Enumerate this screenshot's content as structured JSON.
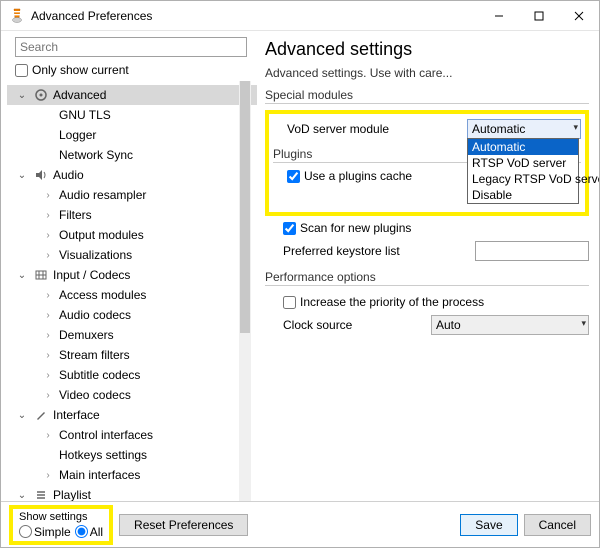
{
  "window": {
    "title": "Advanced Preferences"
  },
  "search": {
    "placeholder": "Search"
  },
  "only_show_current": "Only show current",
  "tree": {
    "advanced": "Advanced",
    "gnu_tls": "GNU TLS",
    "logger": "Logger",
    "network_sync": "Network Sync",
    "audio": "Audio",
    "audio_resampler": "Audio resampler",
    "filters": "Filters",
    "output_modules": "Output modules",
    "visualizations": "Visualizations",
    "input_codecs": "Input / Codecs",
    "access_modules": "Access modules",
    "audio_codecs": "Audio codecs",
    "demuxers": "Demuxers",
    "stream_filters": "Stream filters",
    "subtitle_codecs": "Subtitle codecs",
    "video_codecs": "Video codecs",
    "interface": "Interface",
    "control_interfaces": "Control interfaces",
    "hotkeys_settings": "Hotkeys settings",
    "main_interfaces": "Main interfaces",
    "playlist": "Playlist"
  },
  "right": {
    "heading": "Advanced settings",
    "subtext": "Advanced settings. Use with care...",
    "special_modules": "Special modules",
    "vod_label": "VoD server module",
    "vod_value": "Automatic",
    "vod_options": {
      "o0": "Automatic",
      "o1": "RTSP VoD server",
      "o2": "Legacy RTSP VoD server",
      "o3": "Disable"
    },
    "plugins": "Plugins",
    "use_plugins_cache": "Use a plugins cache",
    "scan_new_plugins": "Scan for new plugins",
    "preferred_keystore": "Preferred keystore list",
    "performance": "Performance options",
    "increase_priority": "Increase the priority of the process",
    "clock_source": "Clock source",
    "clock_value": "Auto"
  },
  "footer": {
    "show_settings": "Show settings",
    "simple": "Simple",
    "all": "All",
    "reset": "Reset Preferences",
    "save": "Save",
    "cancel": "Cancel"
  }
}
